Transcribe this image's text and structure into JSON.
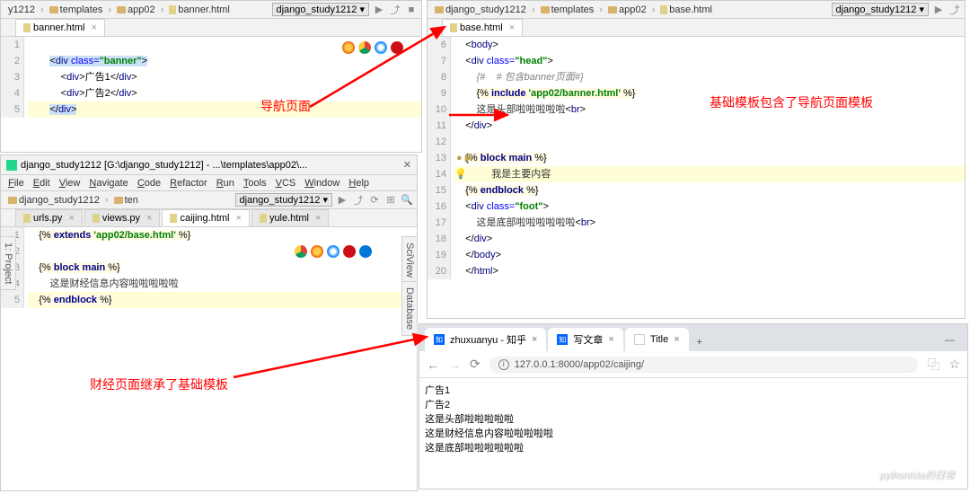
{
  "panel1": {
    "breadcrumb": [
      "y1212",
      "templates",
      "app02",
      "banner.html"
    ],
    "project": "django_study1212",
    "tab": "banner.html",
    "code": [
      {
        "n": "1",
        "ind": 0,
        "html": ""
      },
      {
        "n": "2",
        "ind": 1,
        "html": "<span class='sel'>&lt;<span class='tag'>div </span><span class='attr'>class=</span><span class='str'>\"banner\"</span>&gt;</span>",
        "hl": false
      },
      {
        "n": "3",
        "ind": 2,
        "html": "&lt;<span class='tag'>div</span>&gt;广告1&lt;/<span class='tag'>div</span>&gt;"
      },
      {
        "n": "4",
        "ind": 2,
        "html": "&lt;<span class='tag'>div</span>&gt;广告2&lt;/<span class='tag'>div</span>&gt;"
      },
      {
        "n": "5",
        "ind": 1,
        "html": "<span class='sel'>&lt;/<span class='tag'>div</span>&gt;</span>",
        "hl": true
      }
    ]
  },
  "panel2": {
    "breadcrumb": [
      "django_study1212",
      "templates",
      "app02",
      "base.html"
    ],
    "project": "django_study1212",
    "tab": "base.html",
    "code": [
      {
        "n": "6",
        "ind": 0,
        "html": "&lt;<span class='tag'>body</span>&gt;"
      },
      {
        "n": "7",
        "ind": 0,
        "html": "&lt;<span class='tag'>div </span><span class='attr'>class=</span><span class='str'>\"head\"</span>&gt;"
      },
      {
        "n": "8",
        "ind": 1,
        "html": "<span class='comment'>{#    # 包含banner页面#}</span>"
      },
      {
        "n": "9",
        "ind": 1,
        "html": "<span class='dj'>{% <span class='kw'>include</span> <span class='str'>'app02/banner.html'</span> %}</span>"
      },
      {
        "n": "10",
        "ind": 1,
        "html": "<span class='txt'>这是头部啦啦啦啦啦</span>&lt;<span class='tag'>br</span>&gt;"
      },
      {
        "n": "11",
        "ind": 0,
        "html": "&lt;/<span class='tag'>div</span>&gt;"
      },
      {
        "n": "12",
        "ind": 0,
        "html": ""
      },
      {
        "n": "13",
        "ind": 0,
        "html": "<span class='dj'>{% <span class='kw'>block main</span> %}</span>",
        "marker": true
      },
      {
        "n": "14",
        "ind": 1,
        "html": "<span class='txt'>我是主要内容</span>",
        "hl": true,
        "bulb": true
      },
      {
        "n": "15",
        "ind": 0,
        "html": "<span class='dj'>{% <span class='kw'>endblock</span> %}</span>"
      },
      {
        "n": "16",
        "ind": 0,
        "html": "&lt;<span class='tag'>div </span><span class='attr'>class=</span><span class='str'>\"foot\"</span>&gt;"
      },
      {
        "n": "17",
        "ind": 1,
        "html": "<span class='txt'>这是底部啦啦啦啦啦啦</span>&lt;<span class='tag'>br</span>&gt;"
      },
      {
        "n": "18",
        "ind": 0,
        "html": "&lt;/<span class='tag'>div</span>&gt;"
      },
      {
        "n": "19",
        "ind": 0,
        "html": "&lt;/<span class='tag'>body</span>&gt;"
      },
      {
        "n": "20",
        "ind": 0,
        "html": "&lt;/<span class='tag'>html</span>&gt;"
      }
    ]
  },
  "panel3": {
    "title": "django_study1212 [G:\\django_study1212] - ...\\templates\\app02\\...",
    "menu": [
      "File",
      "Edit",
      "View",
      "Navigate",
      "Code",
      "Refactor",
      "Run",
      "Tools",
      "VCS",
      "Window",
      "Help"
    ],
    "breadcrumb": [
      "django_study1212",
      "ten"
    ],
    "project": "django_study1212",
    "tabs": [
      "urls.py",
      "views.py",
      "caijing.html",
      "yule.html"
    ],
    "active_tab": 2,
    "side_left": "1: Project",
    "side_right_top": "SciView",
    "side_right_bot": "Database",
    "code": [
      {
        "n": "1",
        "ind": 0,
        "html": "<span class='dj'>{% <span class='kw'>extends</span> <span class='str'>'app02/base.html'</span> %}</span>"
      },
      {
        "n": "2",
        "ind": 0,
        "html": ""
      },
      {
        "n": "3",
        "ind": 0,
        "html": "<span class='dj'>{% <span class='kw'>block main</span> %}</span>"
      },
      {
        "n": "4",
        "ind": 1,
        "html": "<span class='txt'>这是财经信息内容啦啦啦啦啦</span>"
      },
      {
        "n": "5",
        "ind": 0,
        "html": "<span class='dj'>{% <span class='kw'>endblock</span> %}</span>",
        "hl": true
      }
    ]
  },
  "browser": {
    "tabs": [
      {
        "label": "zhuxuanyu - 知乎",
        "fav": "知"
      },
      {
        "label": "写文章",
        "fav": "知"
      },
      {
        "label": "Title",
        "fav": ""
      }
    ],
    "url": "127.0.0.1:8000/app02/caijing/",
    "content": [
      "广告1",
      "广告2",
      "这是头部啦啦啦啦啦",
      "这是财经信息内容啦啦啦啦啦",
      "这是底部啦啦啦啦啦啦"
    ]
  },
  "annotations": {
    "a1": "导航页面",
    "a2": "基础模板包含了导航页面模板",
    "a3": "财经页面继承了基础模板"
  },
  "watermark": "pythonista的日常"
}
